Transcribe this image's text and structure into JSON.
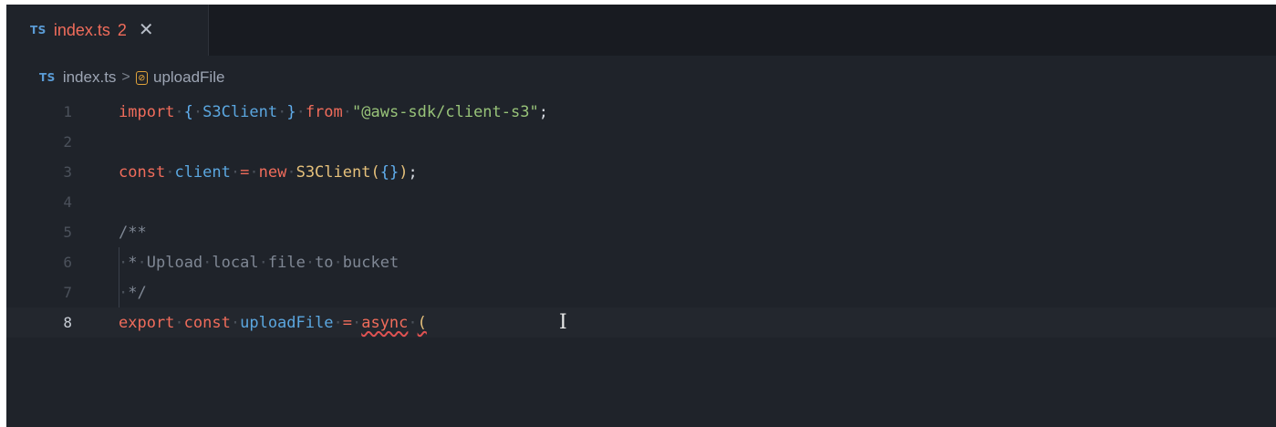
{
  "tab": {
    "badge": "TS",
    "title": "index.ts",
    "problem_count": "2",
    "close": "✕"
  },
  "breadcrumb": {
    "badge": "TS",
    "file": "index.ts",
    "separator": ">",
    "symbol_icon": "symbol-variable-icon",
    "symbol_glyph": "[⊘]",
    "symbol": "uploadFile"
  },
  "editor": {
    "active_line": 8,
    "line_numbers": [
      "1",
      "2",
      "3",
      "4",
      "5",
      "6",
      "7",
      "8"
    ],
    "lines": [
      "import { S3Client } from \"@aws-sdk/client-s3\";",
      "",
      "const client = new S3Client({});",
      "",
      "/**",
      " * Upload local file to bucket",
      " */",
      "export const uploadFile = async ("
    ],
    "tokens": {
      "import": "import",
      "lbrace": "{",
      "s3client": "S3Client",
      "rbrace": "}",
      "from": "from",
      "module": "\"@aws-sdk/client-s3\"",
      "semi": ";",
      "const": "const",
      "client": "client",
      "eq": "=",
      "new": "new",
      "call_open": "(",
      "obj": "{}",
      "call_close": ")",
      "cm_open": "/**",
      "cm_star": "*",
      "cm_text": "Upload local file to bucket",
      "cm_close": "*/",
      "export": "export",
      "uploadFile": "uploadFile",
      "async": "async",
      "paren": "(",
      "ws": "·"
    },
    "cursor_glyph": "I"
  },
  "colors": {
    "background": "#1f232a",
    "keyword": "#f06c5b",
    "identifier": "#5ba7e0",
    "class": "#e5c07b",
    "string": "#98c379",
    "comment": "#7f8794",
    "error_squiggle": "#e05252"
  }
}
